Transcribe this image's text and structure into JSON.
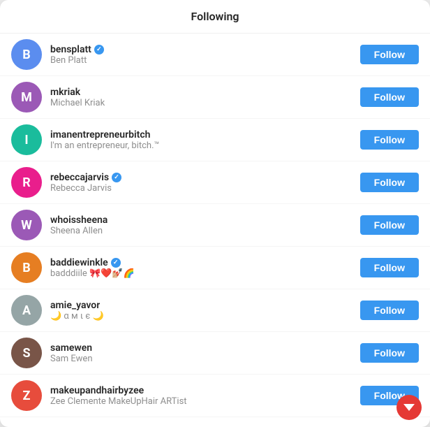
{
  "modal": {
    "title": "Following"
  },
  "users": [
    {
      "id": "bensplatt",
      "username": "bensplatt",
      "display_name": "Ben Platt",
      "verified": true,
      "avatar_color": "av-blue",
      "avatar_letter": "B",
      "follow_label": "Follow"
    },
    {
      "id": "mkriak",
      "username": "mkriak",
      "display_name": "Michael Kriak",
      "verified": false,
      "avatar_color": "av-purple",
      "avatar_letter": "M",
      "follow_label": "Follow"
    },
    {
      "id": "imanentrepreneurbitch",
      "username": "imanentrepreneurbitch",
      "display_name": "I'm an entrepreneur, bitch.™",
      "verified": false,
      "avatar_color": "av-teal",
      "avatar_letter": "I",
      "follow_label": "Follow"
    },
    {
      "id": "rebeccajarvis",
      "username": "rebeccajarvis",
      "display_name": "Rebecca Jarvis",
      "verified": true,
      "avatar_color": "av-pink",
      "avatar_letter": "R",
      "follow_label": "Follow"
    },
    {
      "id": "whoissheena",
      "username": "whoissheena",
      "display_name": "Sheena Allen",
      "verified": false,
      "avatar_color": "av-purple",
      "avatar_letter": "W",
      "follow_label": "Follow"
    },
    {
      "id": "baddiewinkle",
      "username": "baddiewinkle",
      "display_name": "badddiile 🎀❤️💅🏼🌈",
      "verified": true,
      "avatar_color": "av-orange",
      "avatar_letter": "B",
      "follow_label": "Follow"
    },
    {
      "id": "amie_yavor",
      "username": "amie_yavor",
      "display_name": "🌙 α м ι є 🌙",
      "verified": false,
      "avatar_color": "av-gray",
      "avatar_letter": "A",
      "follow_label": "Follow"
    },
    {
      "id": "samewen",
      "username": "samewen",
      "display_name": "Sam Ewen",
      "verified": false,
      "avatar_color": "av-brown",
      "avatar_letter": "S",
      "follow_label": "Follow"
    },
    {
      "id": "makeupandhairbyzee",
      "username": "makeupandhairbyzee",
      "display_name": "Zee Clemente MakeUpHair ARTist",
      "verified": false,
      "avatar_color": "av-red",
      "avatar_letter": "Z",
      "follow_label": "Follow"
    }
  ]
}
